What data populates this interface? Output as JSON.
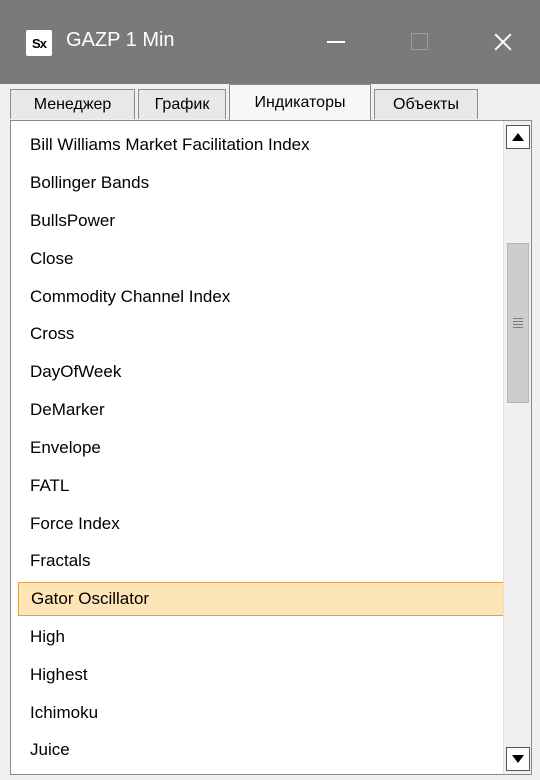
{
  "window": {
    "title": "GAZP 1 Min",
    "icon_label": "Sx",
    "icon_name": "app-logo-icon"
  },
  "tabs": [
    {
      "label": "Менеджер",
      "active": false
    },
    {
      "label": "График",
      "active": false
    },
    {
      "label": "Индикаторы",
      "active": true
    },
    {
      "label": "Объекты",
      "active": false
    }
  ],
  "list": {
    "items": [
      "Bill Williams Market Facilitation Index",
      "Bollinger Bands",
      "BullsPower",
      "Close",
      "Commodity Channel Index",
      "Cross",
      "DayOfWeek",
      "DeMarker",
      "Envelope",
      "FATL",
      "Force Index",
      "Fractals",
      "Gator Oscillator",
      "High",
      "Highest",
      "Ichimoku",
      "Juice"
    ],
    "selected": "Gator Oscillator"
  },
  "colors": {
    "titlebar": "#7a7a7a",
    "selection_bg": "#fde5b8",
    "selection_border": "#e2a24a"
  }
}
